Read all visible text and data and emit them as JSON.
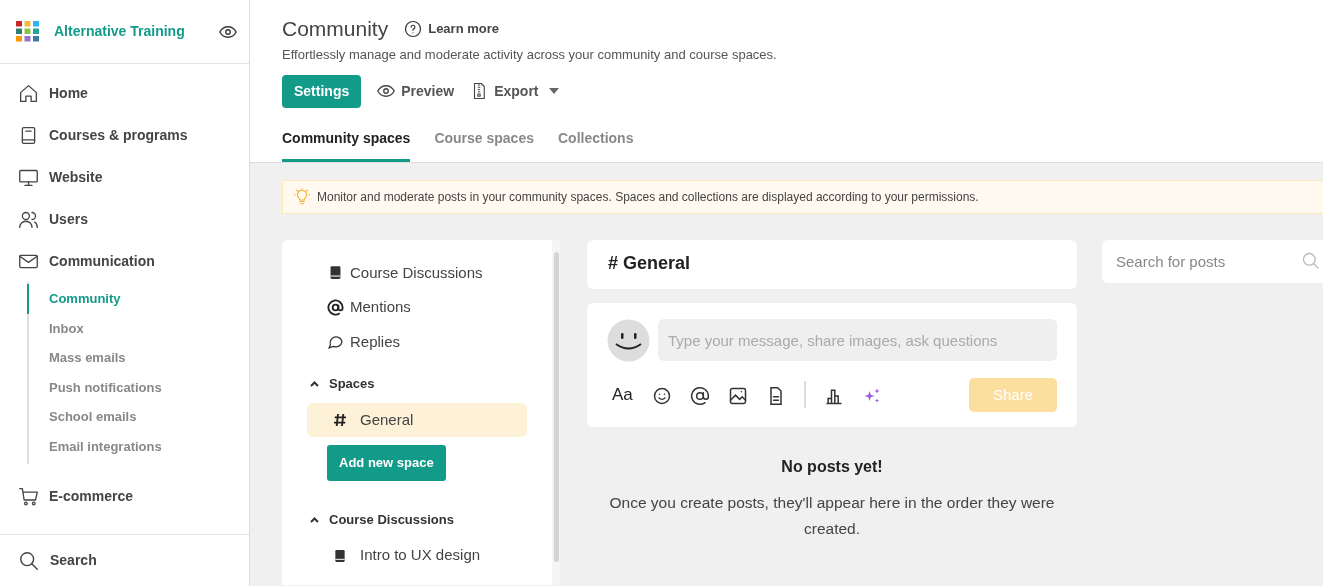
{
  "brand": {
    "name": "Alternative Training"
  },
  "nav": [
    {
      "label": "Home"
    },
    {
      "label": "Courses & programs"
    },
    {
      "label": "Website"
    },
    {
      "label": "Users"
    },
    {
      "label": "Communication",
      "children": [
        {
          "label": "Community",
          "selected": true
        },
        {
          "label": "Inbox",
          "selected": false
        },
        {
          "label": "Mass emails",
          "selected": false
        },
        {
          "label": "Push notifications",
          "selected": false
        },
        {
          "label": "School emails",
          "selected": false
        },
        {
          "label": "Email integrations",
          "selected": false
        }
      ]
    },
    {
      "label": "E-commerce"
    }
  ],
  "sidebar_footer": {
    "label": "Search"
  },
  "header": {
    "title": "Community",
    "learn_more": "Learn more",
    "subtitle": "Effortlessly manage and moderate activity across your community and course spaces.",
    "buttons": [
      {
        "kind": "primary",
        "label": "Settings"
      },
      {
        "kind": "preview",
        "label": "Preview"
      },
      {
        "kind": "export",
        "label": "Export"
      }
    ]
  },
  "tabs": [
    {
      "label": "Community spaces",
      "selected": true
    },
    {
      "label": "Course spaces",
      "selected": false
    },
    {
      "label": "Collections",
      "selected": false
    }
  ],
  "notice": "Monitor and moderate posts in your community spaces. Spaces and collections are displayed according to your permissions.",
  "feed_menu": [
    {
      "kind": "book",
      "label": "Course Discussions"
    },
    {
      "kind": "at",
      "label": "Mentions"
    },
    {
      "kind": "reply",
      "label": "Replies"
    }
  ],
  "sections": [
    {
      "title": "Spaces",
      "expanded": true,
      "items": [
        {
          "kind": "hash",
          "label": "General",
          "selected": true
        }
      ],
      "button": "Add new space"
    },
    {
      "title": "Course Discussions",
      "expanded": true,
      "items": [
        {
          "kind": "book",
          "label": "Intro to UX design",
          "selected": false
        }
      ]
    }
  ],
  "channel": {
    "title": "# General"
  },
  "composer": {
    "placeholder": "Type your message, share images, ask questions",
    "format_label": "Aa",
    "share": {
      "label": "Share",
      "disabled": true
    }
  },
  "empty": {
    "title": "No posts yet!",
    "message": "Once you create posts, they'll appear here in the order they were created."
  },
  "search": {
    "placeholder": "Search for posts"
  }
}
